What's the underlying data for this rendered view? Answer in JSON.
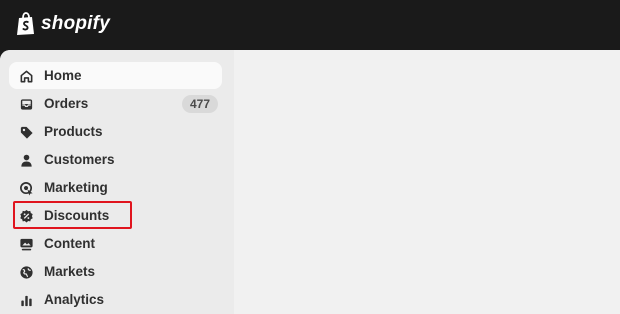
{
  "brand": {
    "name": "shopify",
    "icon": "shopify-bag-icon",
    "color": "#95bf47"
  },
  "sidebar": {
    "items": [
      {
        "label": "Home",
        "icon": "home-icon",
        "active": true
      },
      {
        "label": "Orders",
        "icon": "inbox-icon",
        "badge": "477"
      },
      {
        "label": "Products",
        "icon": "tag-icon"
      },
      {
        "label": "Customers",
        "icon": "person-icon"
      },
      {
        "label": "Marketing",
        "icon": "target-icon"
      },
      {
        "label": "Discounts",
        "icon": "discount-icon",
        "highlighted": true
      },
      {
        "label": "Content",
        "icon": "content-icon"
      },
      {
        "label": "Markets",
        "icon": "globe-icon"
      },
      {
        "label": "Analytics",
        "icon": "bar-chart-icon"
      }
    ]
  },
  "colors": {
    "highlight": "#e0141e",
    "active_bg": "#fafafa",
    "sidebar_bg": "#ebebeb",
    "topbar_bg": "#1a1a1a"
  }
}
